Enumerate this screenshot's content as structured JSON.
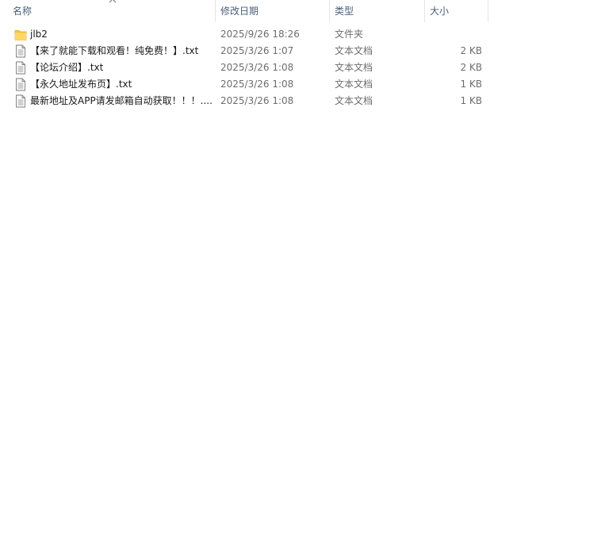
{
  "columns": {
    "name": "名称",
    "date": "修改日期",
    "type": "类型",
    "size": "大小"
  },
  "sort": {
    "column": "name",
    "direction": "ascending",
    "icon": "chevron-up-icon"
  },
  "colors": {
    "header_text": "#4c607a",
    "folder": "#f5c542",
    "separator": "#e5e5e5"
  },
  "files": [
    {
      "name": "jlb2",
      "date": "2025/9/26 18:26",
      "type": "文件夹",
      "size": "",
      "icon": "folder-icon"
    },
    {
      "name": "【来了就能下载和观看！纯免费！】.txt",
      "date": "2025/3/26 1:07",
      "type": "文本文档",
      "size": "2 KB",
      "icon": "text-file-icon"
    },
    {
      "name": "【论坛介绍】.txt",
      "date": "2025/3/26 1:08",
      "type": "文本文档",
      "size": "2 KB",
      "icon": "text-file-icon"
    },
    {
      "name": "【永久地址发布页】.txt",
      "date": "2025/3/26 1:08",
      "type": "文本文档",
      "size": "1 KB",
      "icon": "text-file-icon"
    },
    {
      "name": "最新地址及APP请发邮箱自动获取！！！....",
      "date": "2025/3/26 1:08",
      "type": "文本文档",
      "size": "1 KB",
      "icon": "text-file-icon"
    }
  ]
}
